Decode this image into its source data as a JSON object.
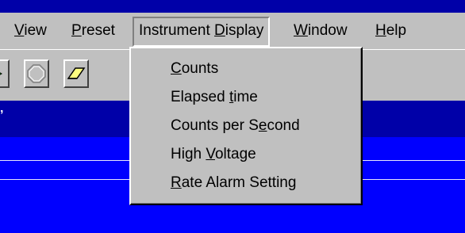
{
  "menubar": {
    "items": [
      {
        "before": "",
        "accel": "V",
        "after": "iew"
      },
      {
        "before": "",
        "accel": "P",
        "after": "reset"
      },
      {
        "before": "Instrument ",
        "accel": "D",
        "after": "isplay"
      },
      {
        "before": "",
        "accel": "W",
        "after": "indow"
      },
      {
        "before": "",
        "accel": "H",
        "after": "elp"
      }
    ]
  },
  "dropdown": {
    "items": [
      {
        "before": "",
        "accel": "C",
        "after": "ounts"
      },
      {
        "before": "Elapsed ",
        "accel": "t",
        "after": "ime"
      },
      {
        "before": "Counts per S",
        "accel": "e",
        "after": "cond"
      },
      {
        "before": "High ",
        "accel": "V",
        "after": "oltage"
      },
      {
        "before": "",
        "accel": "R",
        "after": "ate Alarm Setting"
      }
    ]
  },
  "toolbar": {
    "buttons": [
      {
        "icon": "play-icon"
      },
      {
        "icon": "stop-icon"
      },
      {
        "icon": "eraser-icon"
      }
    ]
  }
}
